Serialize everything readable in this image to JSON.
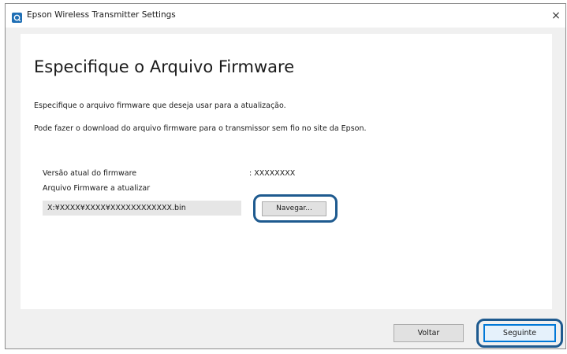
{
  "window": {
    "title": "Epson Wireless Transmitter Settings",
    "close_glyph": "×"
  },
  "page": {
    "heading": "Especifique o Arquivo Firmware",
    "description_1": "Especifique o arquivo firmware que deseja usar para a atualização.",
    "description_2": "Pode fazer o download do arquivo firmware para o transmissor sem fio no site da Epson."
  },
  "firmware": {
    "current_version_label": "Versão atual do firmware",
    "current_version_value": ": XXXXXXXX",
    "file_label": "Arquivo Firmware a atualizar",
    "file_path": "X:¥XXXX¥XXXX¥XXXXXXXXXXXX.bin",
    "browse_label": "Navegar..."
  },
  "footer": {
    "back_label": "Voltar",
    "next_label": "Seguinte"
  },
  "icons": {
    "app_icon": "epson-app-icon",
    "close_icon": "close-icon"
  },
  "colors": {
    "highlight_outline": "#1e5a8f",
    "default_button_border": "#0078d7",
    "default_button_fill": "#e5f1fb"
  }
}
